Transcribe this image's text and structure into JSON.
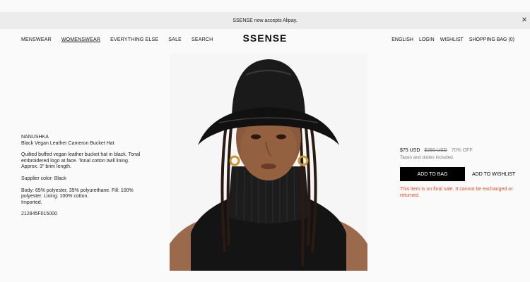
{
  "banner": {
    "text": "SSENSE now accepts Alipay.",
    "close": "×"
  },
  "nav": {
    "left": [
      "MENSWEAR",
      "WOMENSWEAR",
      "EVERYTHING ELSE",
      "SALE",
      "SEARCH"
    ],
    "logo": "SSENSE",
    "right": [
      "ENGLISH",
      "LOGIN",
      "WISHLIST",
      "SHOPPING BAG (0)"
    ]
  },
  "product": {
    "brand": "NANUSHKA",
    "name": "Black Vegan Leather Cameron Bucket Hat",
    "description": "Quilted buffed vegan leather bucket hat in black. Tonal embroidered logo at face. Tonal cotton twill lining. Approx. 3\" brim length.",
    "supplier_color": "Supplier color: Black",
    "composition": "Body: 65% polyester, 35% polyurethane. Fill: 100% polyester. Lining: 100% cotton.",
    "origin": "Imported.",
    "sku": "212845F015000"
  },
  "purchase": {
    "price": "$75 USD",
    "original_price": "$250 USD",
    "discount": "70% OFF",
    "tax_note": "Taxes and duties included.",
    "add_to_bag": "ADD TO BAG",
    "add_to_wishlist": "ADD TO WISHLIST",
    "final_sale": "This item is on final sale. It cannot be exchanged or returned."
  },
  "colors": {
    "accent": "#e54b2a",
    "banner_bg": "#ececec",
    "button_bg": "#000000"
  }
}
